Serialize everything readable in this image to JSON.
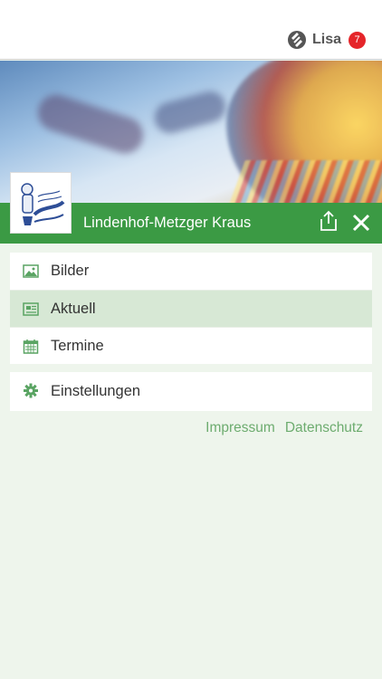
{
  "header": {
    "user_name": "Lisa",
    "notification_count": "7"
  },
  "store": {
    "name": "Lindenhof-Metzger Kraus"
  },
  "menu": {
    "items": [
      {
        "label": "Bilder",
        "icon": "image-icon"
      },
      {
        "label": "Aktuell",
        "icon": "newspaper-icon",
        "active": true
      },
      {
        "label": "Termine",
        "icon": "calendar-icon"
      }
    ],
    "settings_label": "Einstellungen"
  },
  "footer": {
    "impressum": "Impressum",
    "datenschutz": "Datenschutz"
  },
  "colors": {
    "brand_green": "#3b9a44",
    "active_bg": "#d7e8d5",
    "link_green": "#6dac6f",
    "badge_red": "#e5252a"
  }
}
